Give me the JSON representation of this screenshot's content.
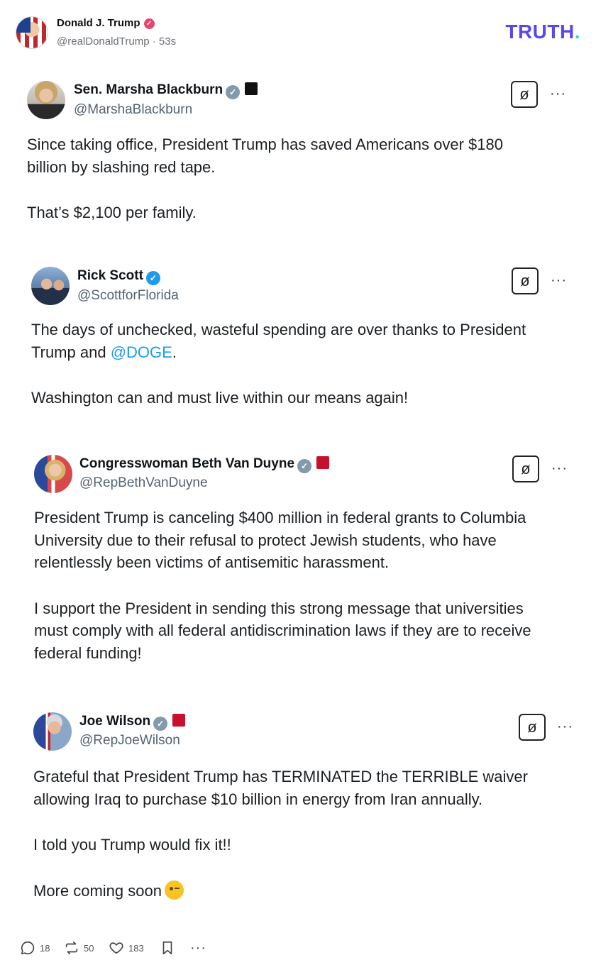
{
  "post": {
    "author_name": "Donald J. Trump",
    "author_handle": "@realDonaldTrump",
    "time": "53s",
    "brand": "TRUTH",
    "brand_dot": ".",
    "verified_icon": "verified-check-icon"
  },
  "tweets": [
    {
      "name": "Sen. Marsha Blackburn",
      "handle": "@MarshaBlackburn",
      "badge": "gray",
      "affiliate_badge": "black",
      "paragraphs": [
        [
          "Since taking office, President Trump has saved Americans over $180",
          "billion by slashing red tape."
        ],
        [
          "That’s $2,100 per family."
        ]
      ]
    },
    {
      "name": "Rick Scott",
      "handle": "@ScottforFlorida",
      "badge": "blue",
      "p1_line1": "The days of unchecked, wasteful spending are over thanks to President",
      "p1_line2_pre": "Trump and ",
      "p1_mention": "@DOGE",
      "p1_line2_post": ".",
      "p2": "Washington can and must live within our means again!"
    },
    {
      "name": "Congresswoman Beth Van Duyne",
      "handle": "@RepBethVanDuyne",
      "badge": "gray",
      "affiliate_badge": "red",
      "paragraphs": [
        [
          "President Trump is canceling $400 million in federal grants to Columbia",
          "University due to their refusal to protect Jewish students, who have",
          "relentlessly been victims of antisemitic harassment."
        ],
        [
          "I support the President in sending this strong message that universities",
          "must comply with all federal antidiscrimination laws if they are to receive",
          "federal funding!"
        ]
      ]
    },
    {
      "name": "Joe Wilson",
      "handle": "@RepJoeWilson",
      "badge": "gray",
      "affiliate_badge": "red",
      "paragraphs": [
        [
          "Grateful that President Trump has TERMINATED the TERRIBLE waiver",
          "allowing Iraq to purchase $10 billion in energy from Iran annually."
        ],
        [
          "I told you Trump would fix it!!"
        ]
      ],
      "last_line": "More coming soon",
      "emoji": "winking-face-emoji"
    }
  ],
  "actions": {
    "replies": "18",
    "retruths": "50",
    "likes": "183"
  },
  "colors": {
    "brand": "#5448ee",
    "brand_dot": "#28d7d1",
    "mention": "#1d9bf0",
    "verified_blue": "#1d9bf0",
    "verified_gray": "#829aab",
    "trump_badge": "#e8456a"
  }
}
